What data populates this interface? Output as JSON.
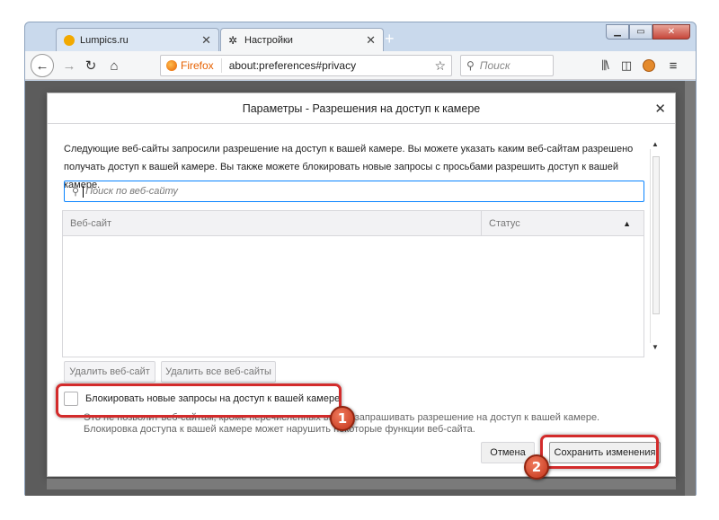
{
  "tabs": [
    {
      "label": "Lumpics.ru",
      "active": false,
      "favicon_color": "#f2a900"
    },
    {
      "label": "Настройки",
      "active": true
    }
  ],
  "navbar": {
    "url_badge": "Firefox",
    "url": "about:preferences#privacy",
    "search_placeholder": "Поиск"
  },
  "dialog": {
    "title": "Параметры - Разрешения на доступ к камере",
    "description": "Следующие веб-сайты запросили разрешение на доступ к вашей камере. Вы можете указать каким веб-сайтам разрешено получать доступ к вашей камере. Вы также можете блокировать новые запросы с просьбами разрешить доступ к вашей камере.",
    "search_placeholder": "Поиск по веб-сайту",
    "columns": {
      "site": "Веб-сайт",
      "status": "Статус"
    },
    "remove_label": "Удалить веб-сайт",
    "remove_all_label": "Удалить все веб-сайты",
    "block_label": "Блокировать новые запросы на доступ к вашей камере",
    "block_hint": "Это не позволит веб-сайтам, кроме перечисленных выше, запрашивать разрешение на доступ к вашей камере. Блокировка доступа к вашей камере может нарушить некоторые функции веб-сайта.",
    "cancel_label": "Отмена",
    "save_label": "Сохранить изменения"
  },
  "annotations": {
    "badge1": "1",
    "badge2": "2",
    "highlight_color": "#d32b2b"
  }
}
